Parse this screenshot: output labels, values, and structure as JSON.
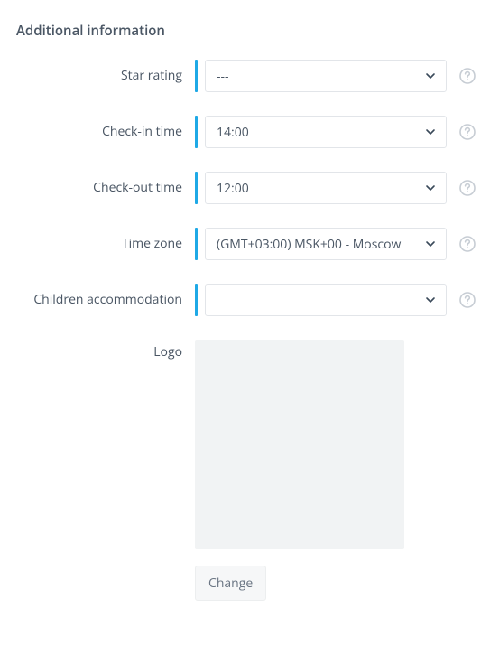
{
  "section": {
    "title": "Additional information"
  },
  "fields": {
    "star_rating": {
      "label": "Star rating",
      "value": "---"
    },
    "check_in": {
      "label": "Check-in time",
      "value": "14:00"
    },
    "check_out": {
      "label": "Check-out time",
      "value": "12:00"
    },
    "time_zone": {
      "label": "Time zone",
      "value": "(GMT+03:00) MSK+00 - Moscow"
    },
    "children_accommodation": {
      "label": "Children accommodation",
      "value": ""
    },
    "logo": {
      "label": "Logo",
      "change_label": "Change"
    }
  }
}
